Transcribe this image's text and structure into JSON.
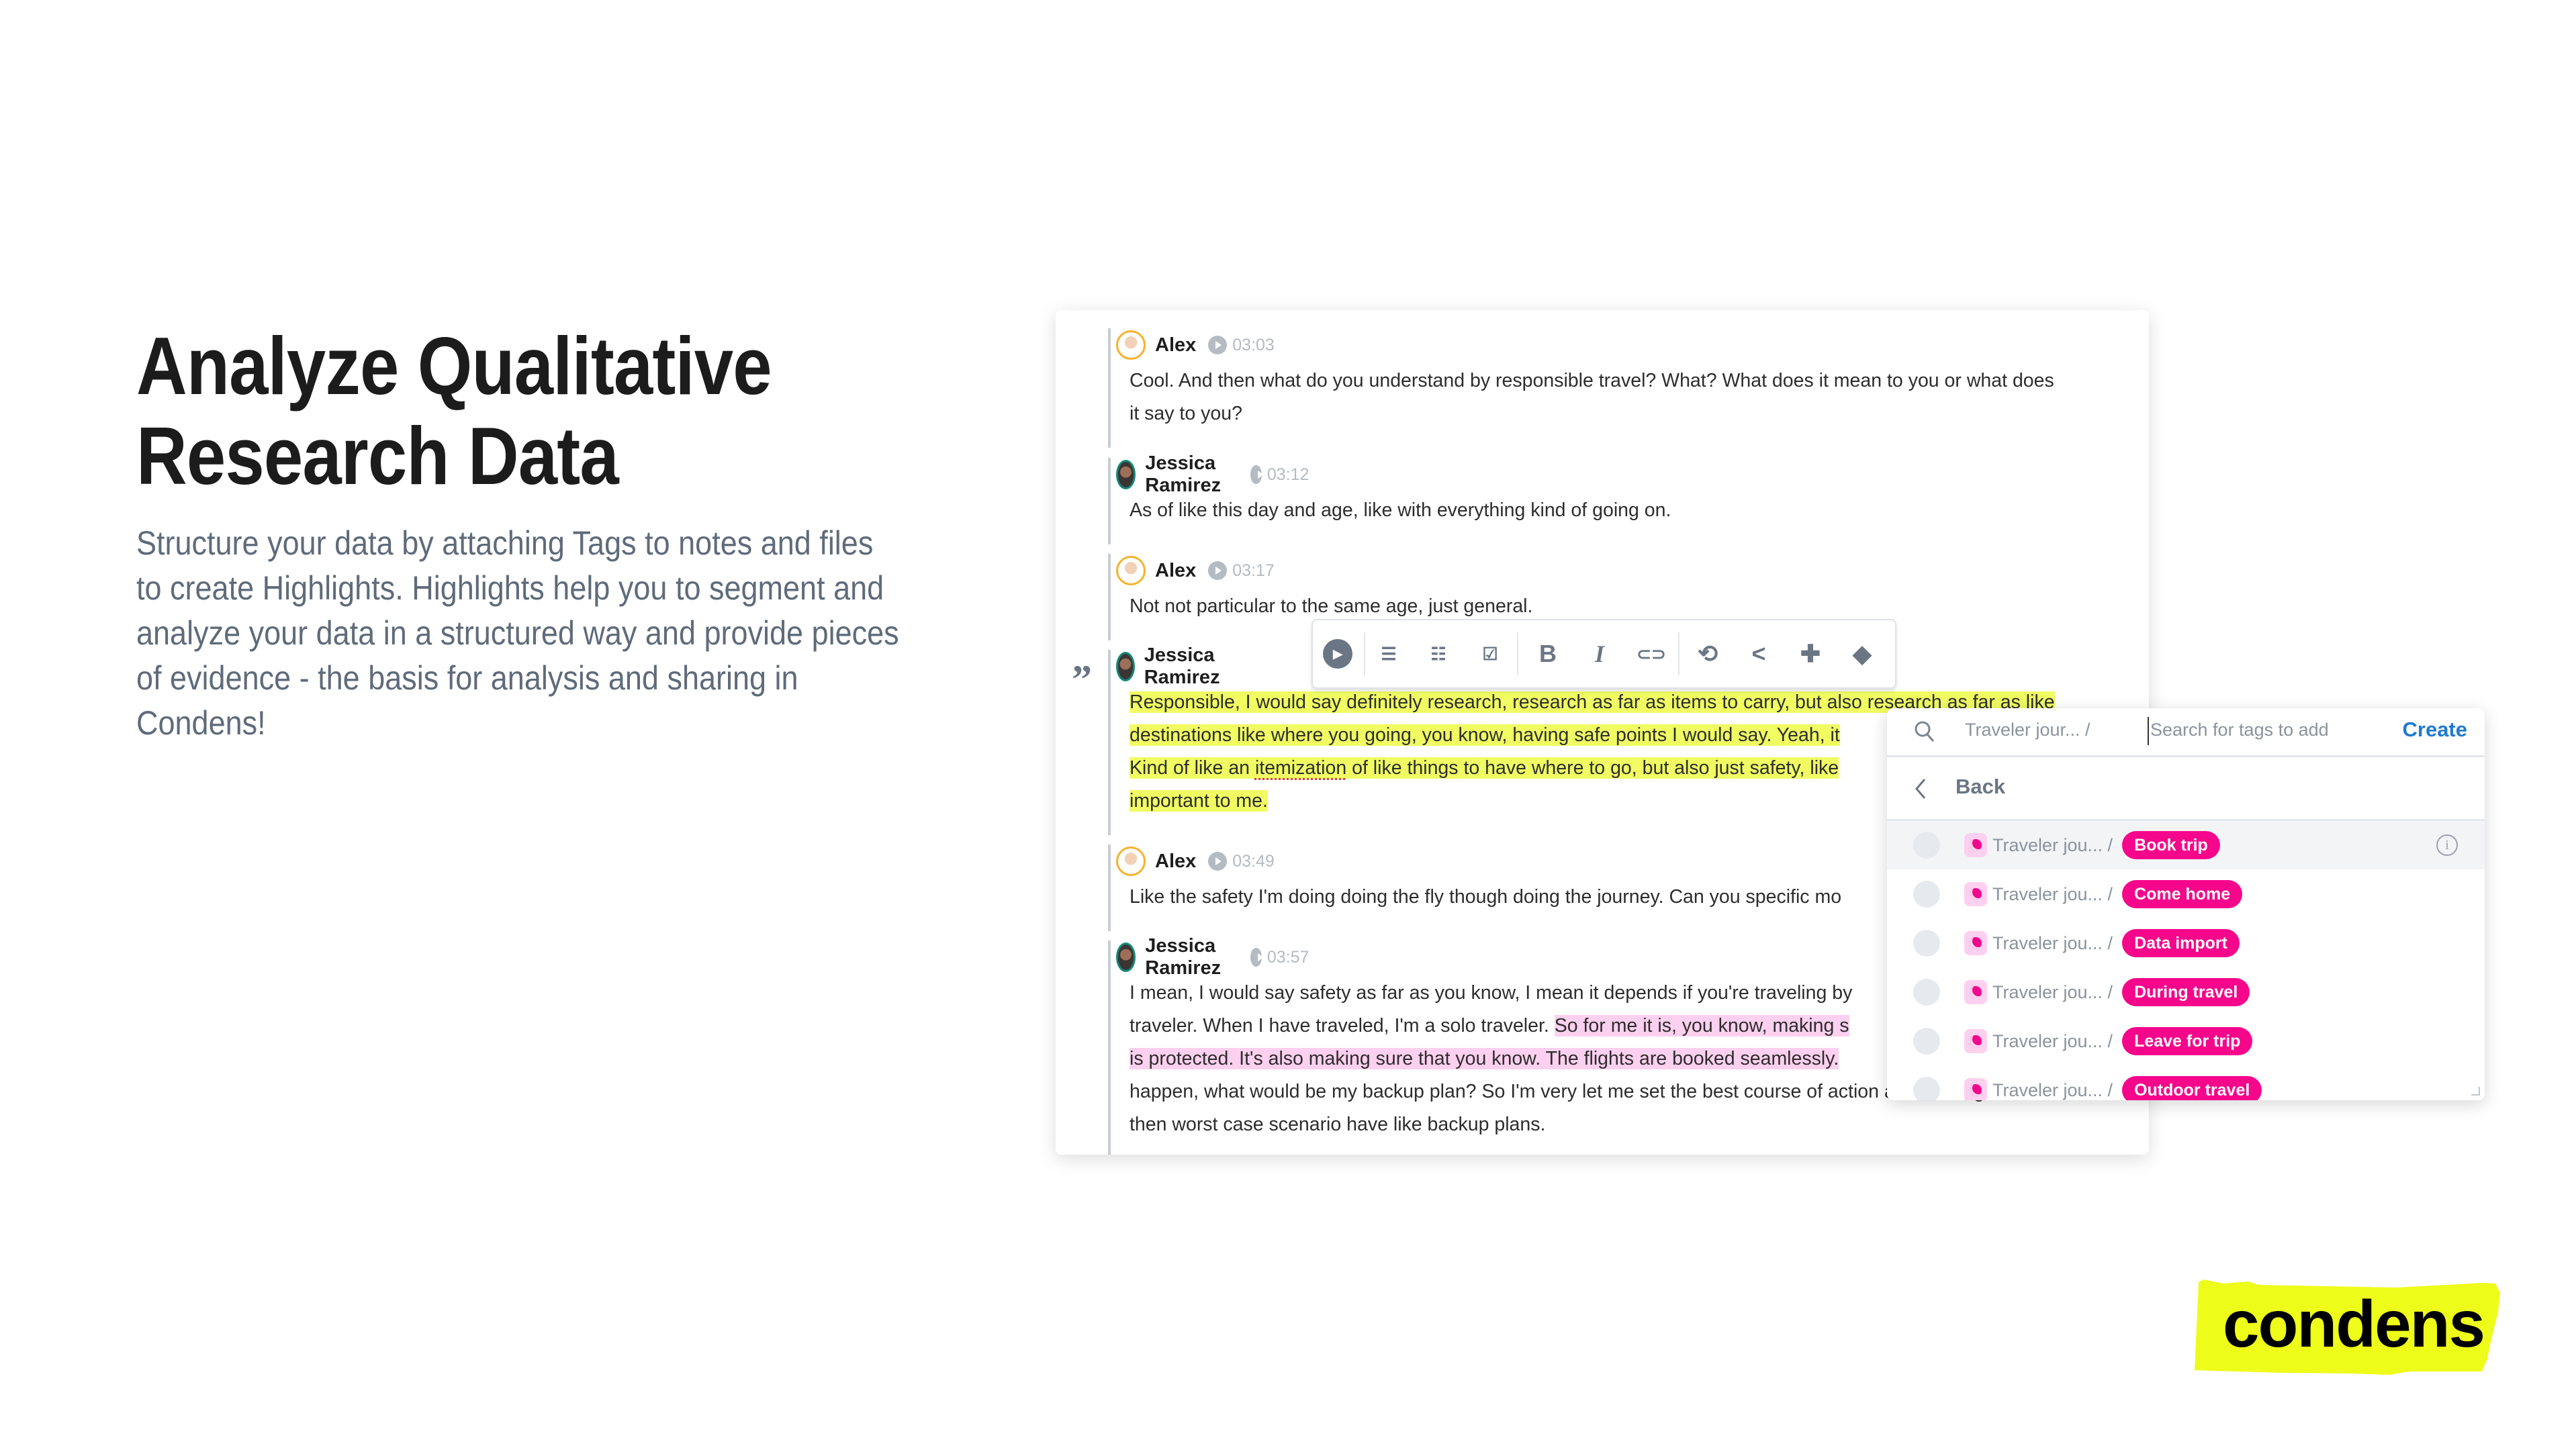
{
  "hero": {
    "title_lines": [
      "Analyze Qualitative",
      "Research Data"
    ],
    "body_lines": [
      "Structure your data by attaching Tags to notes and files",
      "to create Highlights. Highlights help you to segment and",
      "analyze your data in a structured way and provide pieces",
      "of evidence - the basis for analysis and sharing in",
      "Condens!"
    ]
  },
  "transcript": [
    {
      "speaker": "Alex",
      "time": "03:03",
      "avatar": "alex",
      "lines": [
        [
          {
            "t": "Cool. And then what do you understand by responsible travel? What? What does it mean to you or what does"
          }
        ],
        [
          {
            "t": "it say to you?"
          }
        ]
      ]
    },
    {
      "speaker": "Jessica Ramirez",
      "time": "03:12",
      "avatar": "jr",
      "lines": [
        [
          {
            "t": "As of like this day and age, like with everything kind of going on."
          }
        ]
      ]
    },
    {
      "speaker": "Alex",
      "time": "03:17",
      "avatar": "alex",
      "lines": [
        [
          {
            "t": "Not not particular to the same age, just general."
          }
        ]
      ]
    },
    {
      "speaker": "Jessica Ramirez",
      "time": "",
      "avatar": "jr",
      "lines": [
        [
          {
            "t": "Responsible, I would say definitely research, research as far as items to carry, but also research as far as like",
            "hl": "y"
          }
        ],
        [
          {
            "t": "destinations like where you going, you know, having safe points I would say. Yeah, it",
            "hl": "y"
          }
        ],
        [
          {
            "t": "Kind of like an ",
            "hl": "y"
          },
          {
            "t": "itemization",
            "hl": "y",
            "spell": true
          },
          {
            "t": " of like things to have where to go, but also just safety, like",
            "hl": "y"
          }
        ],
        [
          {
            "t": "important to me.",
            "hl": "y"
          }
        ]
      ]
    },
    {
      "speaker": "Alex",
      "time": "03:49",
      "avatar": "alex",
      "lines": [
        [
          {
            "t": "Like the safety I'm doing doing the fly though doing the journey. Can you specific mo"
          }
        ]
      ]
    },
    {
      "speaker": "Jessica Ramirez",
      "time": "03:57",
      "avatar": "jr",
      "lines": [
        [
          {
            "t": "I mean, I would say safety as far as you know, I mean it depends if you're traveling by"
          }
        ],
        [
          {
            "t": "traveler. When I have traveled, I'm a solo traveler. "
          },
          {
            "t": "So for me it is, you know, making s",
            "hl": "p"
          }
        ],
        [
          {
            "t": "is protected. It's also making sure that you know. The flights are booked seamlessly.",
            "hl": "p"
          }
        ],
        [
          {
            "t": "happen, what would be my backup plan? So I'm very let me set the best course of action at the first go. And"
          }
        ],
        [
          {
            "t": "then worst case scenario have like backup plans."
          }
        ]
      ]
    }
  ],
  "toolbar": {
    "icons": [
      "play-icon",
      "bullet-list-icon",
      "numbered-list-icon",
      "checklist-icon",
      "bold-icon",
      "italic-icon",
      "link-icon",
      "search-replace-icon",
      "share-icon",
      "add-comment-icon",
      "tag-icon"
    ],
    "glyphs": [
      "▶",
      "☰",
      "☷",
      "☑",
      "B",
      "I",
      "⊂⊃",
      "⟲",
      "<",
      "✚",
      "◆"
    ]
  },
  "tag_picker": {
    "search_prefix": "Traveler jour... /",
    "search_placeholder": "Search for tags to add",
    "create_label": "Create",
    "back_label": "Back",
    "crumb": "Traveler jou... /",
    "tags": [
      "Book trip",
      "Come home",
      "Data import",
      "During travel",
      "Leave for trip",
      "Outdoor travel"
    ],
    "tag_color": "#f5068b"
  },
  "brand": {
    "logo_text": "condens",
    "logo_bg": "#eefc1a"
  },
  "colors": {
    "highlight_yellow": "#f0fc62",
    "highlight_pink": "#fdd0ef",
    "create_blue": "#1f7ad1"
  }
}
